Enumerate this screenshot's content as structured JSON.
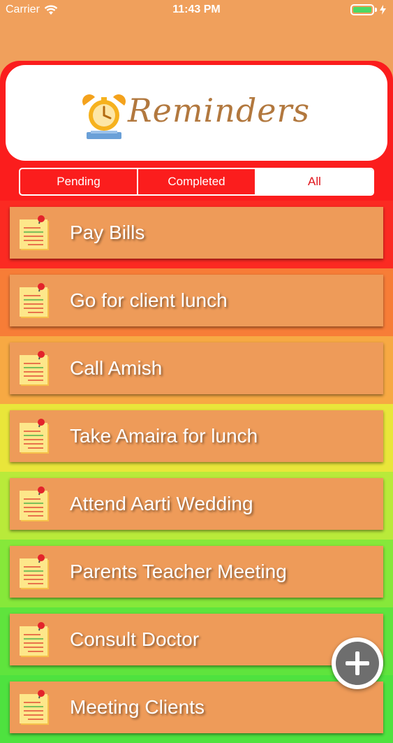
{
  "status_bar": {
    "carrier": "Carrier",
    "time": "11:43 PM",
    "wifi_icon": "wifi-icon",
    "battery_icon": "battery-charging-icon"
  },
  "header": {
    "logo_text": "Reminders",
    "logo_icon": "alarm-clock-icon"
  },
  "tabs": {
    "items": [
      {
        "label": "Pending",
        "selected": false
      },
      {
        "label": "Completed",
        "selected": false
      },
      {
        "label": "All",
        "selected": true
      }
    ]
  },
  "colors": {
    "header_red": "#fb1d1d",
    "card_orange": "#ee9b59",
    "row_gradient": [
      "#fb2a22",
      "#f77d37",
      "#f7a943",
      "#e9e63a",
      "#b9ea3a",
      "#86e83a",
      "#5fe43d",
      "#4ee23f"
    ]
  },
  "reminders": [
    {
      "title": "Pay Bills"
    },
    {
      "title": "Go for client lunch"
    },
    {
      "title": "Call Amish"
    },
    {
      "title": "Take Amaira for lunch"
    },
    {
      "title": "Attend Aarti Wedding"
    },
    {
      "title": "Parents Teacher Meeting"
    },
    {
      "title": "Consult Doctor"
    },
    {
      "title": "Meeting Clients"
    }
  ],
  "add_button": {
    "icon": "plus-icon"
  }
}
